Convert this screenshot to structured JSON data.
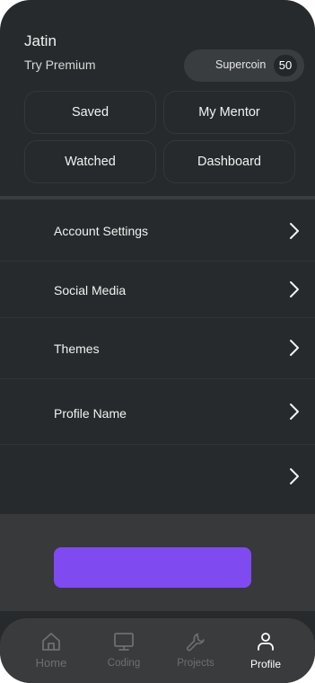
{
  "header": {
    "user_name": "Jatin",
    "premium_link": "Try Premium"
  },
  "supercoin": {
    "label": "Supercoin",
    "count": "50"
  },
  "quick_actions": {
    "saved": "Saved",
    "my_mentor": "My Mentor",
    "watched": "Watched",
    "dashboard": "Dashboard"
  },
  "menu": [
    {
      "label": "Account Settings",
      "icon": "chevron-right-icon"
    },
    {
      "label": "Social Media",
      "icon": "chevron-right-icon"
    },
    {
      "label": "Themes",
      "icon": "chevron-right-icon"
    },
    {
      "label": "Profile Name",
      "icon": "chevron-right-icon"
    },
    {
      "label": "",
      "icon": "chevron-right-icon"
    }
  ],
  "cta": {
    "color": "#7f4af0"
  },
  "bottom_nav": {
    "items": [
      {
        "label": "Home",
        "icon": "home-icon"
      },
      {
        "label": "Coding",
        "icon": "monitor-icon"
      },
      {
        "label": "Projects",
        "icon": "wrench-icon"
      },
      {
        "label": "Profile",
        "icon": "user-icon"
      }
    ],
    "active": "Profile"
  },
  "colors": {
    "background": "#262a2c",
    "accent": "#7f4af0",
    "nav_active": "#ffffff",
    "nav_inactive": "#6d6f71"
  }
}
